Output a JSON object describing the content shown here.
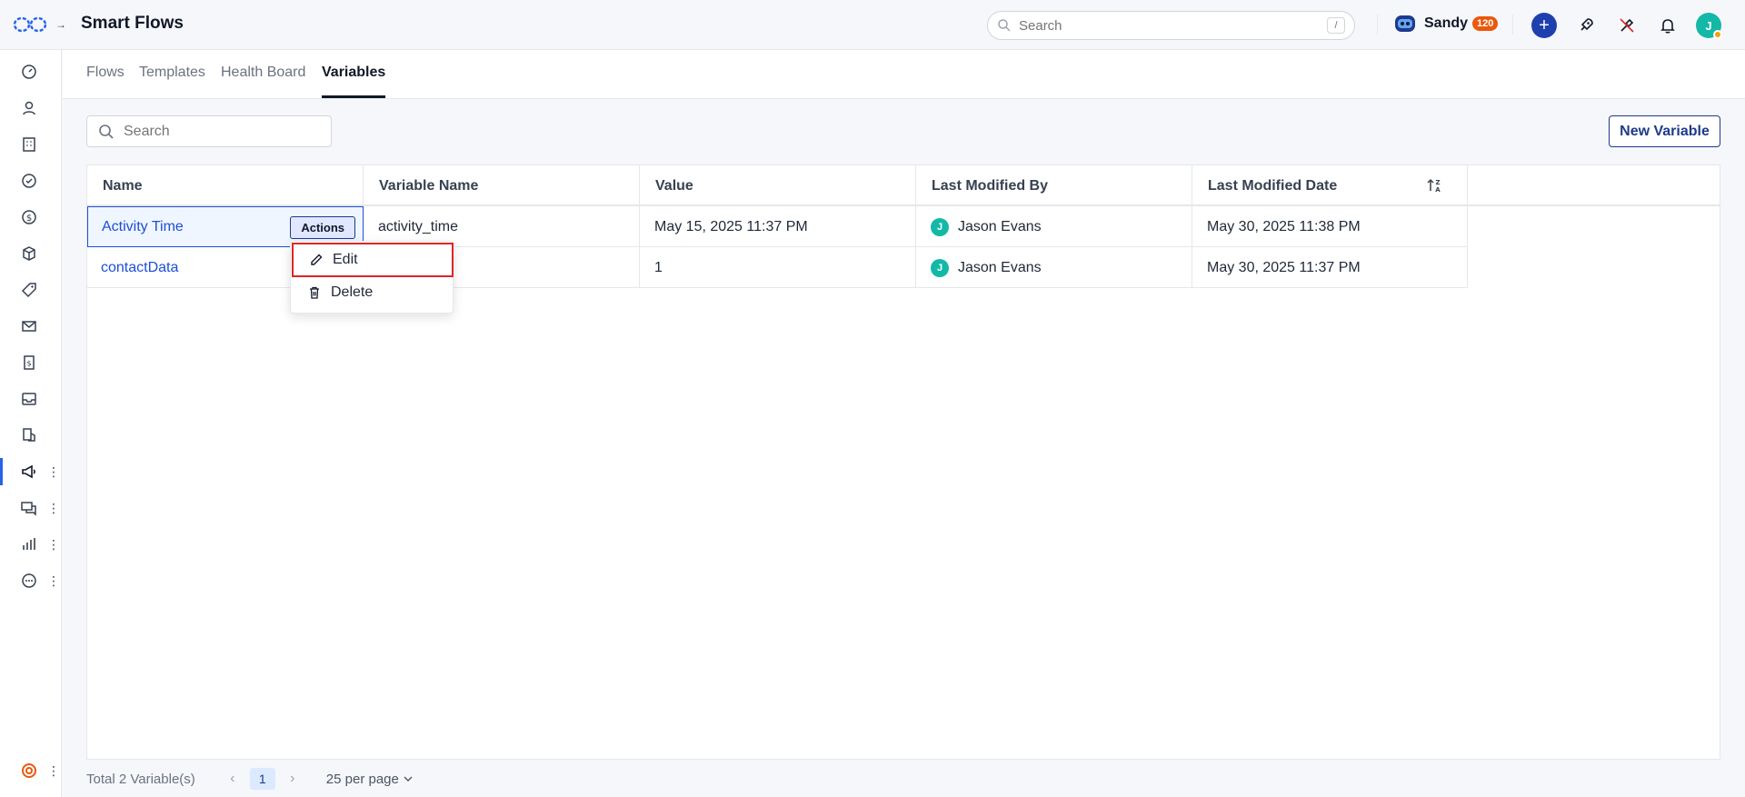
{
  "app": {
    "title": "Smart Flows"
  },
  "header": {
    "search_placeholder": "Search",
    "search_shortcut": "/",
    "assistant_name": "Sandy",
    "assistant_badge": "120",
    "user_initial": "J"
  },
  "sidebar": {
    "items": [
      {
        "name": "dashboard-icon"
      },
      {
        "name": "contacts-icon"
      },
      {
        "name": "companies-icon"
      },
      {
        "name": "tasks-icon"
      },
      {
        "name": "deals-icon"
      },
      {
        "name": "products-icon"
      },
      {
        "name": "tag-icon"
      },
      {
        "name": "mail-icon"
      },
      {
        "name": "invoice-icon"
      },
      {
        "name": "inbox-icon"
      },
      {
        "name": "automation-icon"
      },
      {
        "name": "campaigns-icon",
        "active": true
      },
      {
        "name": "chat-icon"
      },
      {
        "name": "reports-icon"
      },
      {
        "name": "more-icon"
      }
    ],
    "help_icon": "lifebuoy-icon"
  },
  "tabs": [
    {
      "label": "Flows"
    },
    {
      "label": "Templates"
    },
    {
      "label": "Health Board"
    },
    {
      "label": "Variables",
      "active": true
    }
  ],
  "toolbar": {
    "search_placeholder": "Search",
    "new_button": "New Variable"
  },
  "table": {
    "columns": [
      "Name",
      "Variable Name",
      "Value",
      "Last Modified By",
      "Last Modified Date"
    ],
    "rows": [
      {
        "name": "Activity Time",
        "variable_name": "activity_time",
        "value": "May 15, 2025 11:37 PM",
        "modified_by": "Jason Evans",
        "modified_by_initial": "J",
        "modified_date": "May 30, 2025 11:38 PM"
      },
      {
        "name": "contactData",
        "variable_name": "",
        "value": "1",
        "modified_by": "Jason Evans",
        "modified_by_initial": "J",
        "modified_date": "May 30, 2025 11:37 PM"
      }
    ],
    "actions_label": "Actions"
  },
  "menu": {
    "items": [
      {
        "label": "Edit",
        "icon": "pencil-icon"
      },
      {
        "label": "Delete",
        "icon": "trash-icon"
      }
    ]
  },
  "footer": {
    "total": "Total 2 Variable(s)",
    "page": "1",
    "per_page": "25 per page"
  },
  "colors": {
    "accent": "#1e40af",
    "link": "#1d4ed8",
    "highlight": "#dc2626",
    "avatar": "#14b8a6",
    "badge": "#ea580c"
  }
}
